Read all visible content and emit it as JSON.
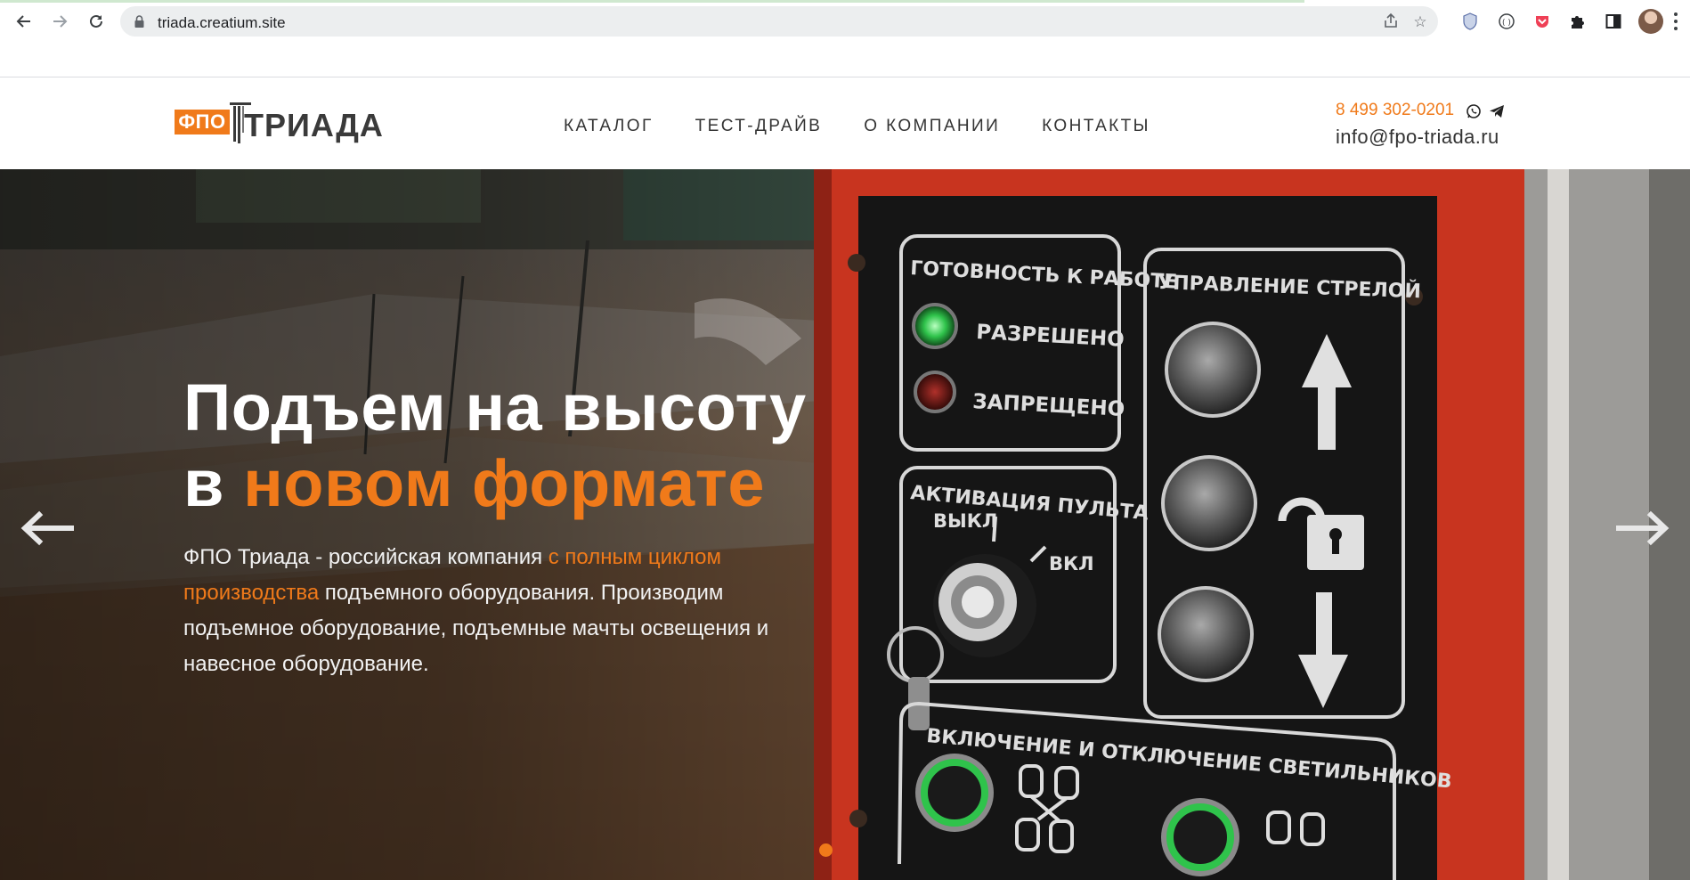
{
  "browser": {
    "url": "triada.creatium.site",
    "icons": [
      "back-icon",
      "forward-icon",
      "reload-icon",
      "lock-icon",
      "share-icon",
      "star-icon",
      "shield-extension-icon",
      "code-extension-icon",
      "pocket-extension-icon",
      "puzzle-icon",
      "sidepanel-icon",
      "avatar",
      "kebab-menu-icon"
    ]
  },
  "site": {
    "logo": {
      "badge": "ФПО",
      "word": "ТРИАДА"
    },
    "menu": [
      {
        "label": "КАТАЛОГ"
      },
      {
        "label": "ТЕСТ-ДРАЙВ"
      },
      {
        "label": "О КОМПАНИИ"
      },
      {
        "label": "КОНТАКТЫ"
      }
    ],
    "contact": {
      "phone": "8 499 302-0201",
      "email": "info@fpo-triada.ru"
    }
  },
  "hero": {
    "title_line1": "Подъем на высоту",
    "title_prefix": "в ",
    "title_accent": "новом формате",
    "text_part1": "ФПО Триада - российская компания ",
    "text_accent": "с полным циклом производства",
    "text_part2": " подъемного оборудования. Производим подъемное оборудование, подъемные мачты освещения и навесное оборудование.",
    "panel": {
      "ready": "ГОТОВНОСТЬ К РАБОТЕ",
      "allowed": "РАЗРЕШЕНО",
      "forbidden": "ЗАПРЕЩЕНО",
      "boom": "УПРАВЛЕНИЕ СТРЕЛОЙ",
      "activation": "АКТИВАЦИЯ ПУЛЬТА",
      "off": "ВЫКЛ",
      "on": "ВКЛ",
      "lights": "ВКЛЮЧЕНИЕ И ОТКЛЮЧЕНИЕ СВЕТИЛЬНИКОВ"
    },
    "slides_count": 1,
    "active_slide": 1
  },
  "colors": {
    "accent": "#f07a1a",
    "panel_red": "#c8341f",
    "panel_black": "#151515"
  }
}
